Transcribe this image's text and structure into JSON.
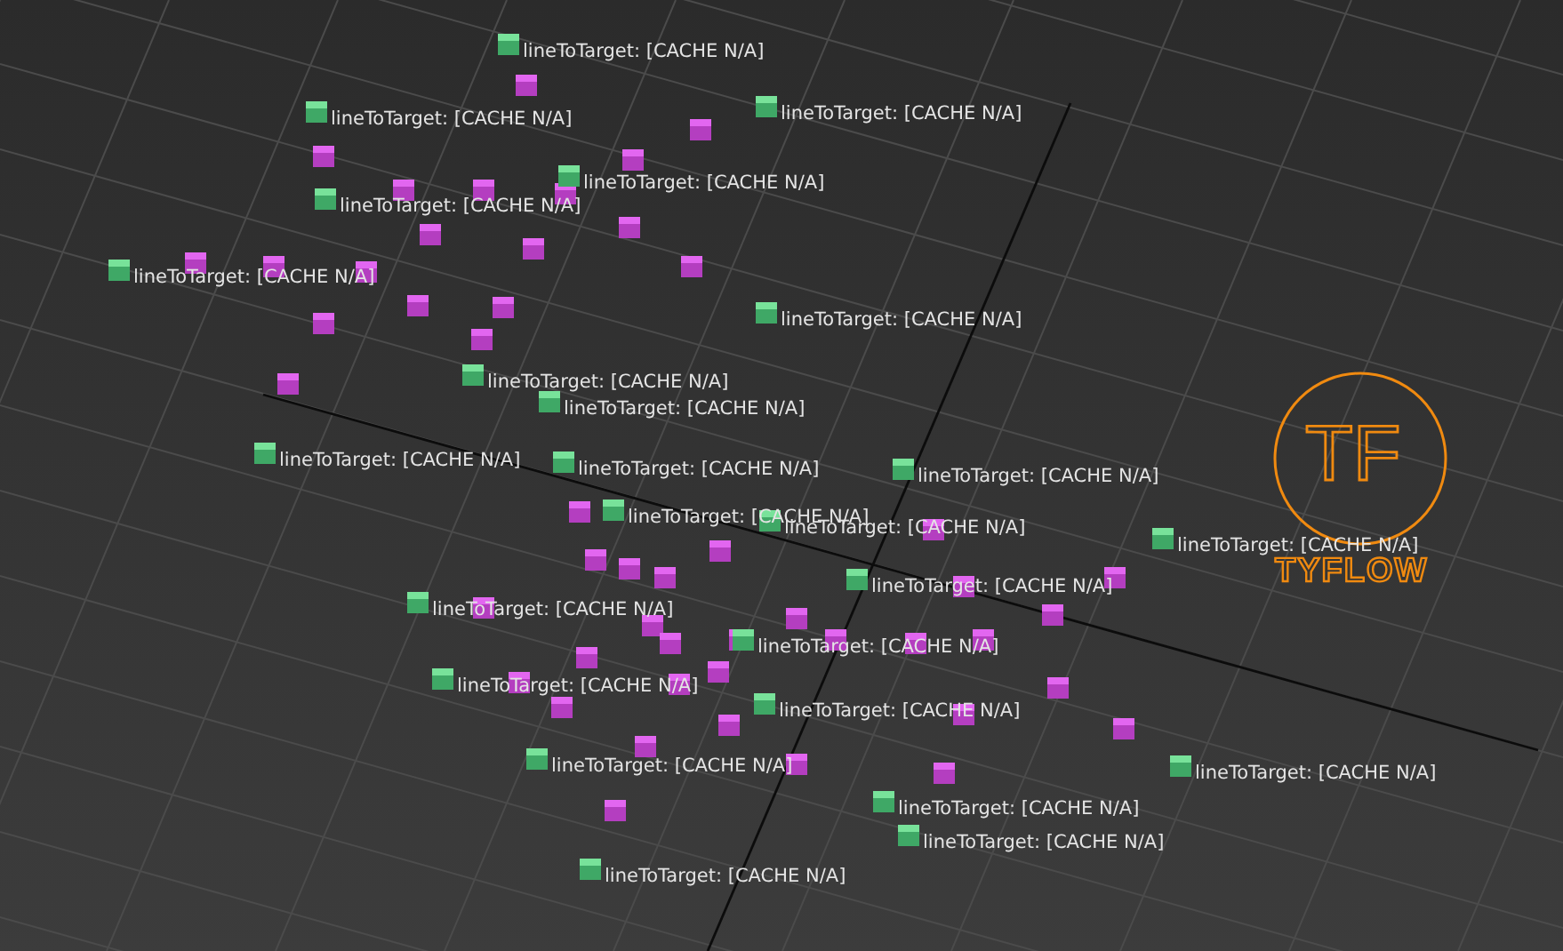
{
  "viewport": {
    "labels": [
      "lineToTarget: [CACHE N/A]",
      "lineToTarget: [CACHE N/A]",
      "lineToTarget: [CACHE N/A]",
      "lineToTarget: [CACHE N/A]",
      "lineToTarget: [CACHE N/A]",
      "lineToTarget: [CACHE N/A]",
      "lineToTarget: [CACHE N/A]",
      "lineToTarget: [CACHE N/A]",
      "lineToTarget: [CACHE N/A]",
      "lineToTarget: [CACHE N/A]",
      "lineToTarget: [CACHE N/A]",
      "lineToTarget: [CACHE N/A]",
      "lineToTarget: [CACHE N/A]",
      "lineToTarget: [CACHE N/A]",
      "lineToTarget: [CACHE N/A]",
      "lineToTarget: [CACHE N/A]",
      "lineToTarget: [CACHE N/A]",
      "lineToTarget: [CACHE N/A]",
      "lineToTarget: [CACHE N/A]",
      "lineToTarget: [CACHE N/A]",
      "lineToTarget: [CACHE N/A]",
      "lineToTarget: [CACHE N/A]",
      "lineToTarget: [CACHE N/A]",
      "lineToTarget: [CACHE N/A]",
      "lineToTarget: [CACHE N/A]"
    ],
    "logo": {
      "monogram": "TF",
      "text": "TYFLOW"
    }
  }
}
